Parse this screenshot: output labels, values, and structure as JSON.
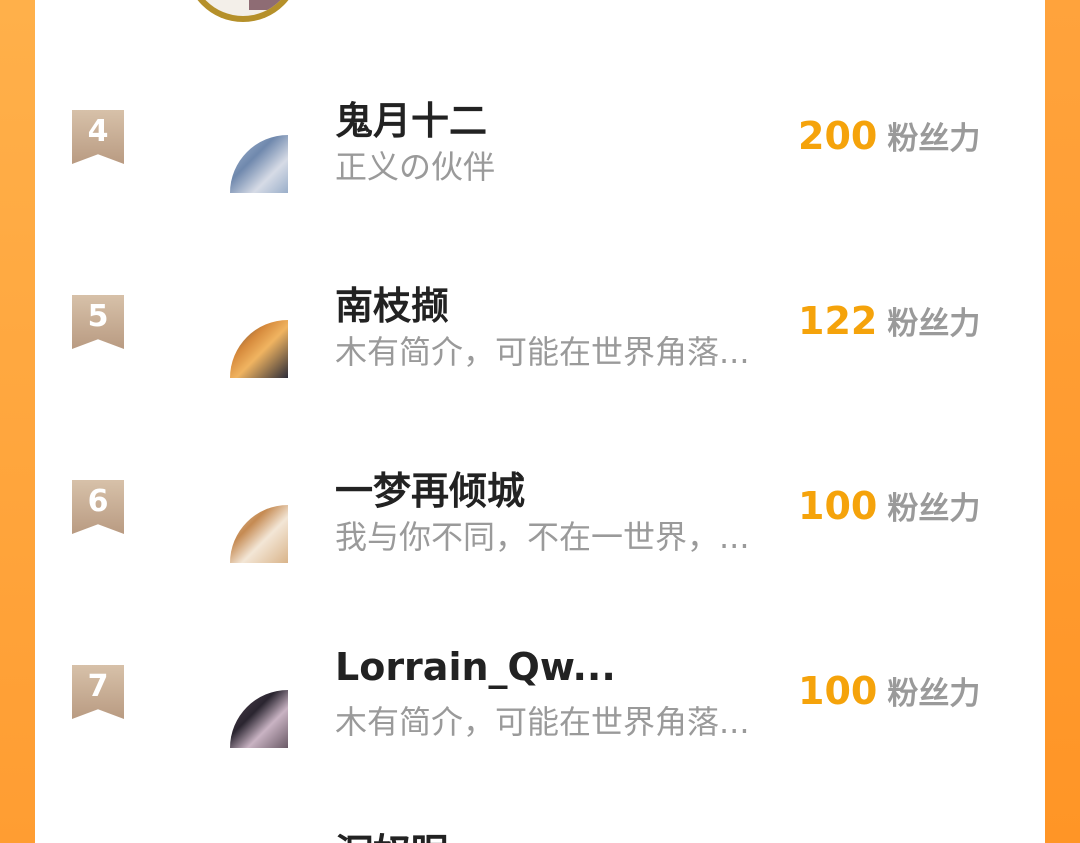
{
  "colors": {
    "accent": "#f5a30b",
    "frame": "#ff9d32",
    "badge": "#c7ad95",
    "name": "#222222",
    "secondary": "#9a9a9a"
  },
  "list": {
    "rows": [
      {
        "rank": "4",
        "name": "鬼月十二",
        "bio": "正义の伙伴",
        "fans": "200",
        "unit": "粉丝力"
      },
      {
        "rank": "5",
        "name": "南枝撷",
        "bio": "木有简介，可能在世界角落...",
        "fans": "122",
        "unit": "粉丝力"
      },
      {
        "rank": "6",
        "name": "一梦再倾城",
        "bio": "我与你不同，不在一世界，...",
        "fans": "100",
        "unit": "粉丝力"
      },
      {
        "rank": "7",
        "name": "Lorrain_Qw...",
        "bio": "木有简介，可能在世界角落...",
        "fans": "100",
        "unit": "粉丝力"
      }
    ],
    "partial_next_name": "沉奴眠"
  }
}
